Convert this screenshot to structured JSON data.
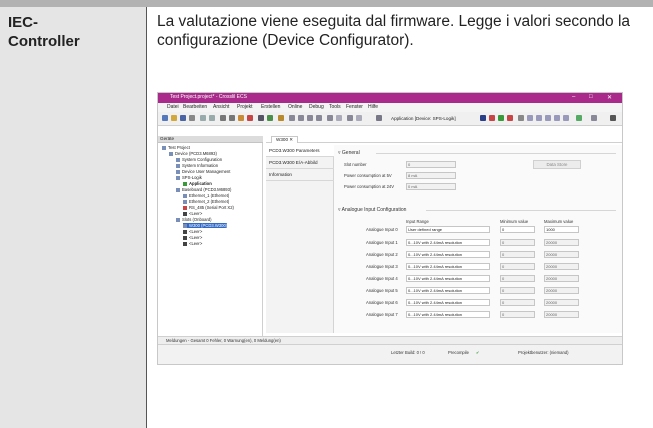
{
  "row": {
    "label": "IEC-\nController",
    "description": "La valutazione viene eseguita dal firmware. Legge i valori secondo la configurazione (Device Configurator)."
  },
  "app": {
    "window_title": "Test Project.project* - Crosslil ECS",
    "menu": [
      "Datei",
      "Bearbeiten",
      "Ansicht",
      "Projekt",
      "Erstellen",
      "Online",
      "Debug",
      "Tools",
      "Fenster",
      "Hilfe"
    ],
    "app_selector": "Application [Device: SPS-Logik]",
    "device_panel_title": "Geräte",
    "tree": [
      {
        "label": "Test Project",
        "level": 0
      },
      {
        "label": "Device (PCD3.M6893)",
        "level": 1
      },
      {
        "label": "System Configuration",
        "level": 2
      },
      {
        "label": "System Information",
        "level": 2
      },
      {
        "label": "Device User Management",
        "level": 2
      },
      {
        "label": "SPS-Logik",
        "level": 2
      },
      {
        "label": "Application",
        "level": 3
      },
      {
        "label": "Baseboard (PCD3.M6893)",
        "level": 2
      },
      {
        "label": "Ethernet_1 (Ethernet)",
        "level": 3
      },
      {
        "label": "Ethernet_2 (Ethernet)",
        "level": 3
      },
      {
        "label": "RS_485 (Serial Port X2)",
        "level": 3
      },
      {
        "label": "<Leer>",
        "level": 3
      },
      {
        "label": "Slots (Onboard)",
        "level": 2
      },
      {
        "label": "W300 (PCD3.W300)",
        "level": 3
      },
      {
        "label": "<Leer>",
        "level": 3
      },
      {
        "label": "<Leer>",
        "level": 3
      },
      {
        "label": "<Leer>",
        "level": 3
      }
    ],
    "editor_tab": "W300",
    "subnav": [
      "PCD3.W300 Parameters",
      "PCD3.W300 E/A-Abbild",
      "Information"
    ],
    "general": {
      "header": "General",
      "rows": [
        {
          "label": "Slot number",
          "value": "0"
        },
        {
          "label": "Power consumption at 5V",
          "value": "8 mA"
        },
        {
          "label": "Power consumption at 24V",
          "value": "0 mA"
        }
      ],
      "button": "Data Store"
    },
    "analogue": {
      "header": "Analogue Input Configuration",
      "col_range": "Input Range",
      "col_min": "Minimum value",
      "col_max": "Maximum value",
      "rows": [
        {
          "label": "Analogue Input 0",
          "range": "User defined range",
          "min": "0",
          "max": "1000"
        },
        {
          "label": "Analogue Input 1",
          "range": "0...10V with 2.44mA resolution",
          "min": "0",
          "max": "20000"
        },
        {
          "label": "Analogue Input 2",
          "range": "0...10V with 2.44mA resolution",
          "min": "0",
          "max": "20000"
        },
        {
          "label": "Analogue Input 3",
          "range": "0...10V with 2.44mA resolution",
          "min": "0",
          "max": "20000"
        },
        {
          "label": "Analogue Input 4",
          "range": "0...10V with 2.44mA resolution",
          "min": "0",
          "max": "20000"
        },
        {
          "label": "Analogue Input 5",
          "range": "0...10V with 2.44mA resolution",
          "min": "0",
          "max": "20000"
        },
        {
          "label": "Analogue Input 6",
          "range": "0...10V with 2.44mA resolution",
          "min": "0",
          "max": "20000"
        },
        {
          "label": "Analogue Input 7",
          "range": "0...10V with 2.44mA resolution",
          "min": "0",
          "max": "20000"
        }
      ]
    },
    "messages_bar": "Meldungen - Gesamt 0 Fehler, 0 Warnung(en), 0 Meldung(en)",
    "status": {
      "last_build": "Letzter Build: 0 ! 0",
      "precompile": "Precompile",
      "project_user": "Projektbenutzer: (niemand)"
    }
  }
}
